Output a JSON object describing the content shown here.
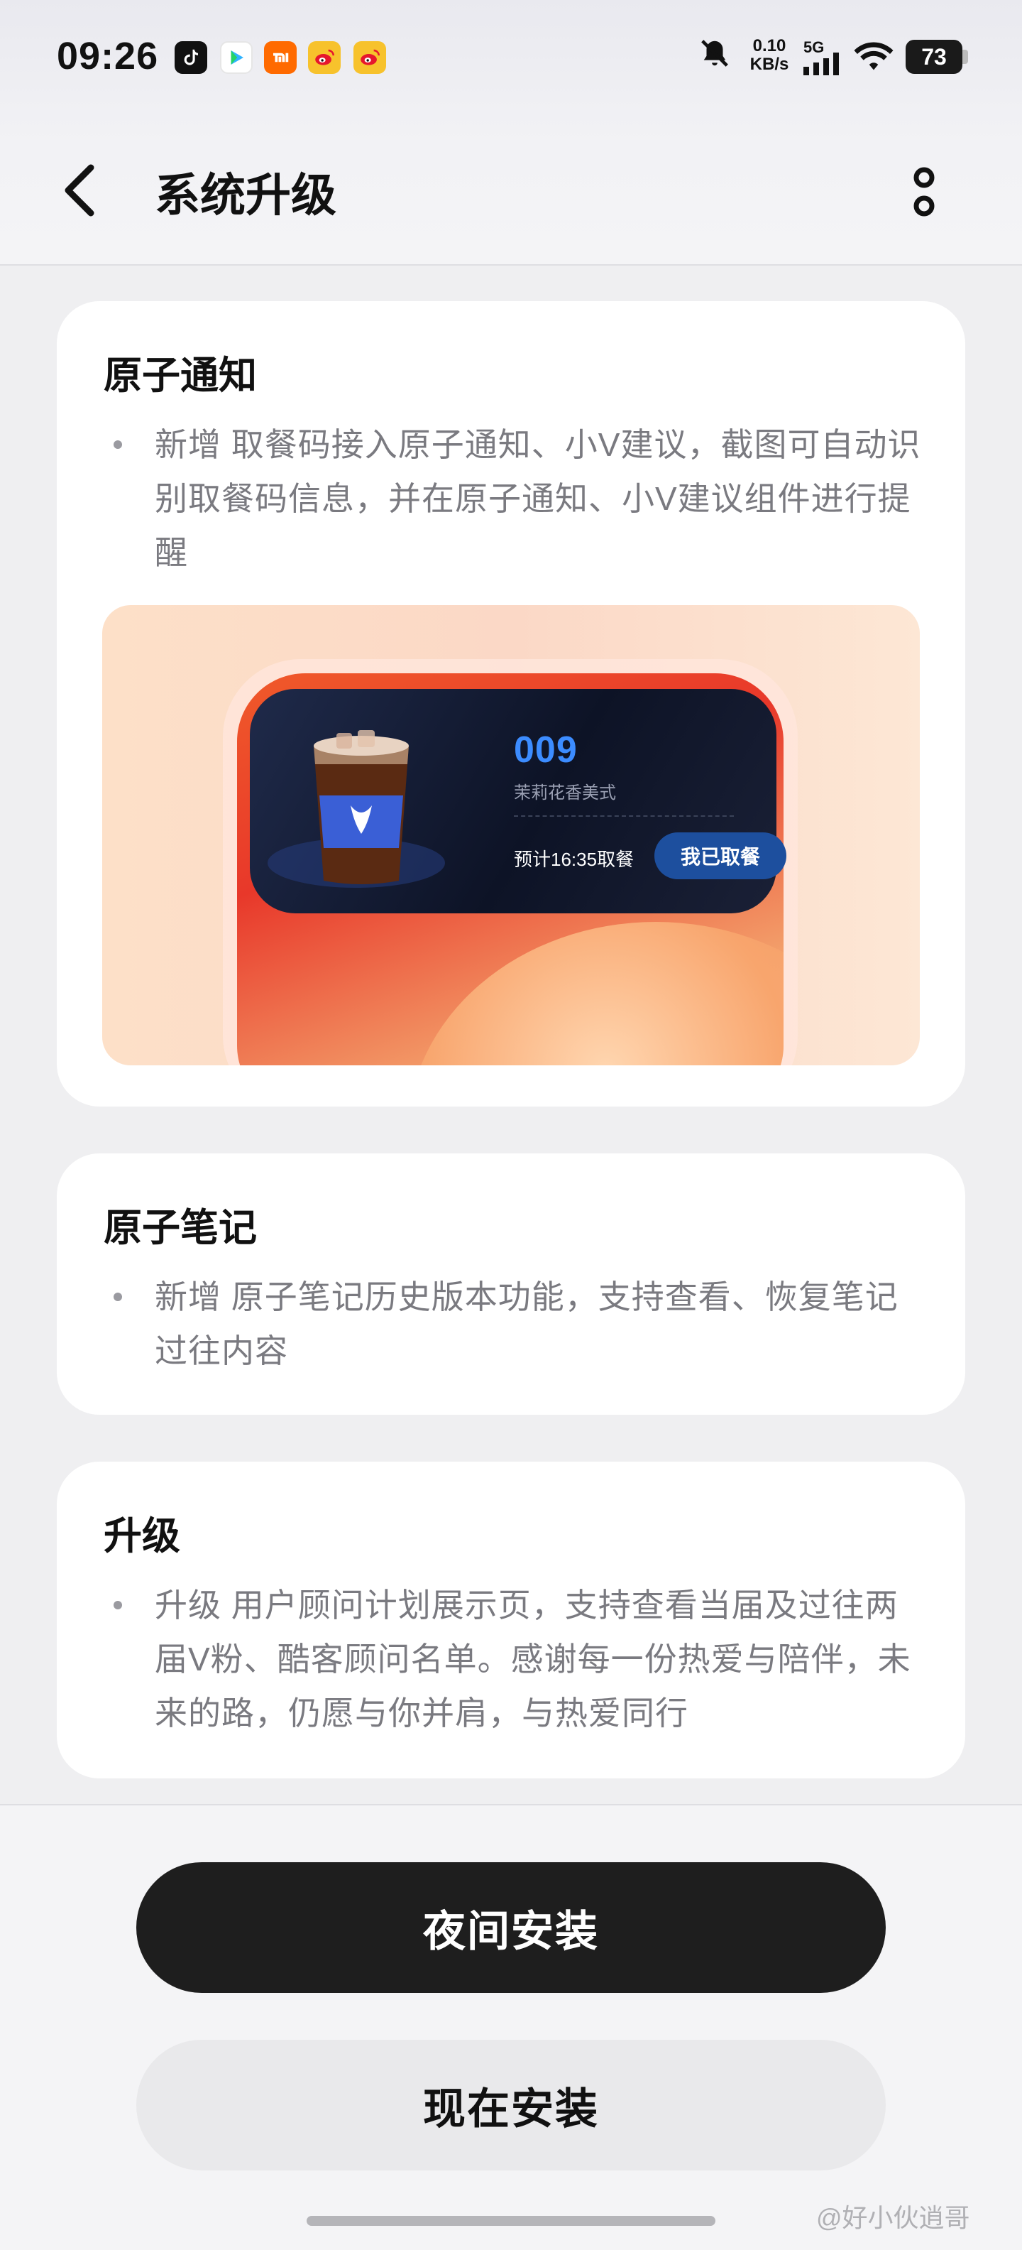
{
  "status_bar": {
    "time": "09:26",
    "net_speed_value": "0.10",
    "net_speed_unit": "KB/s",
    "network_type": "5G",
    "battery": "73"
  },
  "header": {
    "title": "系统升级"
  },
  "cards": [
    {
      "title": "原子通知",
      "text": "新增 取餐码接入原子通知、小V建议，截图可自动识别取餐码信息，并在原子通知、小V建议组件进行提醒"
    },
    {
      "title": "原子笔记",
      "text": "新增 原子笔记历史版本功能，支持查看、恢复笔记过往内容"
    },
    {
      "title": "升级",
      "text": "升级 用户顾问计划展示页，支持查看当届及过往两届V粉、酷客顾问名单。感谢每一份热爱与陪伴，未来的路，仍愿与你并肩，与热爱同行"
    }
  ],
  "illustration": {
    "order_number": "009",
    "item_name": "茉莉花香美式",
    "eta_text": "预计16:35取餐",
    "picked_button": "我已取餐"
  },
  "actions": {
    "install_at_night": "夜间安装",
    "install_now": "现在安装"
  },
  "watermark": "@好小伙逍哥",
  "colors": {
    "primary_button": "#1e1e1e",
    "order_number_blue": "#3c8cff",
    "picked_button_blue": "#1d4f9e"
  }
}
